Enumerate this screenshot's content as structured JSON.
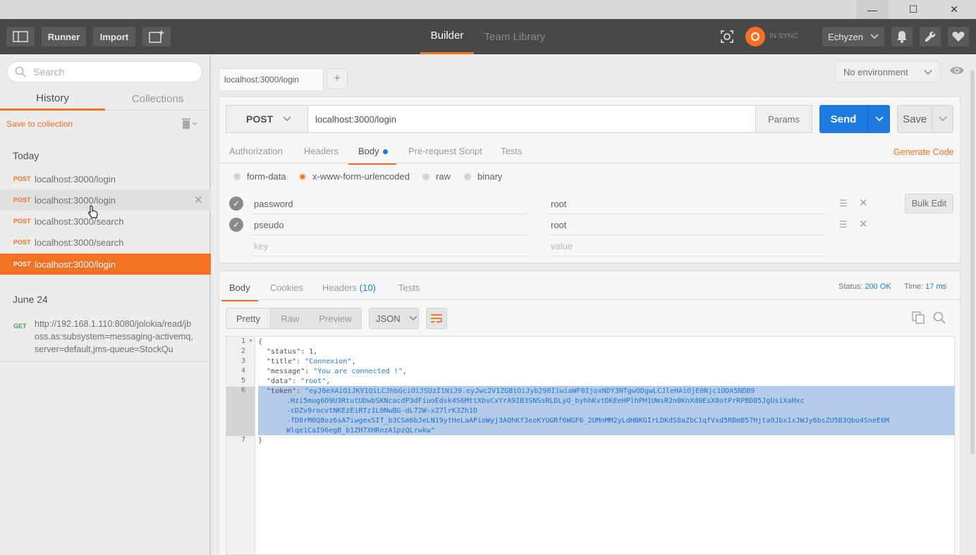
{
  "window": {
    "min": "—",
    "max": "☐",
    "close": "✕"
  },
  "header": {
    "runner": "Runner",
    "import": "Import",
    "tab_builder": "Builder",
    "tab_team": "Team Library",
    "sync": "IN SYNC",
    "user": "Echyzen",
    "accent_color": "#f47023"
  },
  "sidebar": {
    "search_placeholder": "Search",
    "tab_history": "History",
    "tab_collections": "Collections",
    "save_to_collection": "Save to collection",
    "today": "Today",
    "today_items": [
      {
        "method": "POST",
        "url": "localhost:3000/login"
      },
      {
        "method": "POST",
        "url": "localhost:3000/login"
      },
      {
        "method": "POST",
        "url": "localhost:3000/search"
      },
      {
        "method": "POST",
        "url": "localhost:3000/search"
      },
      {
        "method": "POST",
        "url": "localhost:3000/login"
      }
    ],
    "june": "June 24",
    "june_item": {
      "method": "GET",
      "url": "http://192.168.1.110:8080/jolokia/read/jboss.as:subsystem=messaging-activemq,server=default,jms-queue=StockQu"
    }
  },
  "request": {
    "tab_label": "localhost:3000/login",
    "environment": "No environment",
    "method": "POST",
    "url": "localhost:3000/login",
    "params": "Params",
    "send": "Send",
    "save": "Save",
    "subtabs": [
      "Authorization",
      "Headers",
      "Body",
      "Pre-request Script",
      "Tests"
    ],
    "generate_code": "Generate Code",
    "body_types": [
      "form-data",
      "x-www-form-urlencoded",
      "raw",
      "binary"
    ],
    "rows": [
      {
        "key": "password",
        "value": "root"
      },
      {
        "key": "pseudo",
        "value": "root"
      }
    ],
    "key_placeholder": "key",
    "value_placeholder": "value",
    "bulk_edit": "Bulk Edit"
  },
  "response": {
    "tabs": {
      "body": "Body",
      "cookies": "Cookies",
      "headers": "Headers",
      "headers_count": "(10)",
      "tests": "Tests"
    },
    "status_label": "Status:",
    "status_value": "200 OK",
    "time_label": "Time:",
    "time_value": "17 ms",
    "formats": [
      "Pretty",
      "Raw",
      "Preview"
    ],
    "json": "JSON",
    "lines": [
      "1",
      "2",
      "3",
      "4",
      "5",
      "6",
      "7"
    ],
    "code": {
      "l1": "{",
      "l2": "  \"status\": 1,",
      "l3_key": "  \"title\": ",
      "l3_val": "\"Connexion\"",
      "l3_end": ",",
      "l4_key": "  \"message\": ",
      "l4_val": "\"You are connected !\"",
      "l4_end": ",",
      "l5_key": "  \"data\": ",
      "l5_val": "\"root\"",
      "l5_end": ",",
      "l6_key": "  \"token\": ",
      "l6_q": "\"",
      "tok1": "eyJ0eXAiOiJKV1QiLCJhbGciOiJSUzI1NiJ9.eyJwc2V1ZG8iOiJyb290IiwiaWF0IjoxNDY3NTgwODgwLCJleHAiOjE0Njc1ODA5NDB9",
      "tok2": ".Hzi5mug6O9U3RtutUDwbSKNcacdP3dFiuoEdsk4S6MttXbvCxYrA9IB3SNSsRLDLyQ_byhhKvtDKEeHPlhPH1UWsR2n0KnXd0EsX8otPrRPBD85JgUsiXaHxc",
      "tok3": "-cDZv9rocvtNKEzEiRTz1L0NwBG-dL72W-xZ7lrK3Zh1O",
      "tok4": "-fD8rM0Q8oz6sA7iwgexSIf_b3CSm6bJeLN19ytHeLaAPioWyj3AQhKf3eoKYUGRf6WGF6_2UMnMM2yLdHNKGIrLDKdS8aZbC1qfVxd5RBmB57Hjta9Jbx1xJWJy6bsZU5B3Qbu4SneE6M",
      "tok5": "Wlqe1CaI96egB_b1ZH7XHRnzA1pzQLrwkw\"",
      "l7": "}"
    }
  }
}
